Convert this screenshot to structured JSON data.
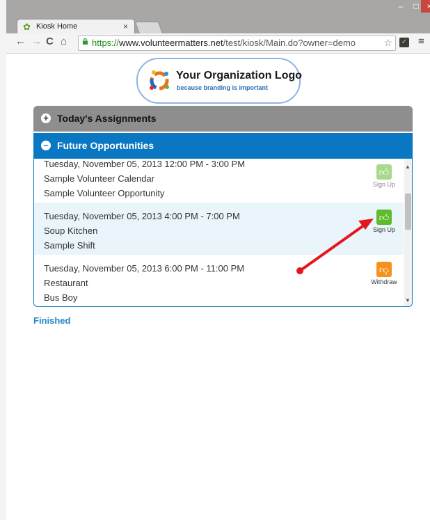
{
  "browser": {
    "tab_title": "Kiosk Home",
    "tab_close": "×",
    "url_scheme": "https://",
    "url_host": "www.volunteermatters.net",
    "url_path": "/test/kiosk/Main.do?owner=demo",
    "window_min": "–",
    "window_max": "□",
    "window_close": "×"
  },
  "logo": {
    "title": "Your Organization Logo",
    "subtitle": "because branding is important"
  },
  "sections": {
    "today_label": "Today's Assignments",
    "future_label": "Future Opportunities"
  },
  "opportunities": [
    {
      "date": "Tuesday, November 05, 2013 12:00 PM - 3:00 PM",
      "calendar": "Sample Volunteer Calendar",
      "name": "Sample Volunteer Opportunity",
      "action": "Sign Up"
    },
    {
      "date": "Tuesday, November 05, 2013 4:00 PM - 7:00 PM",
      "calendar": "Soup Kitchen",
      "name": "Sample Shift",
      "action": "Sign Up"
    },
    {
      "date": "Tuesday, November 05, 2013 6:00 PM - 11:00 PM",
      "calendar": "Restaurant",
      "name": "Bus Boy",
      "action": "Withdraw"
    }
  ],
  "finished_label": "Finished",
  "colors": {
    "accent": "#0a77c2",
    "signup": "#5dbb2c",
    "withdraw": "#f5921e",
    "annotation_arrow": "#e8141b"
  }
}
